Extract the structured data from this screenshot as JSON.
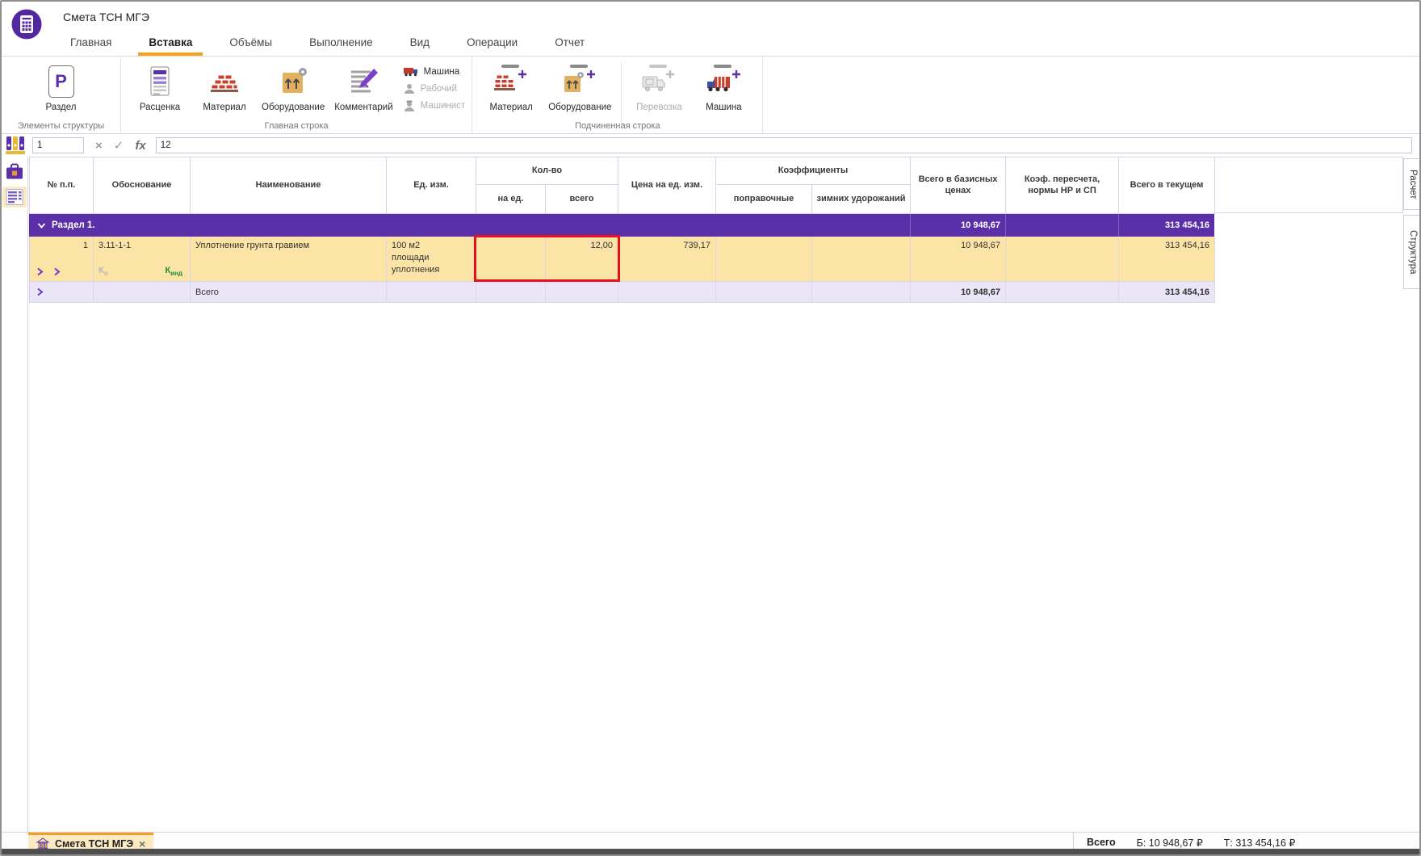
{
  "app": {
    "title": "Смета ТСН МГЭ"
  },
  "menu": {
    "tabs": [
      {
        "label": "Главная"
      },
      {
        "label": "Вставка",
        "active": true
      },
      {
        "label": "Объёмы"
      },
      {
        "label": "Выполнение"
      },
      {
        "label": "Вид"
      },
      {
        "label": "Операции"
      },
      {
        "label": "Отчет"
      }
    ]
  },
  "ribbon": {
    "groups": {
      "g1": "Элементы структуры",
      "g2": "Главная строка",
      "g3": "Подчиненная строка"
    },
    "buttons": {
      "razdel": "Раздел",
      "razdel_glyph": "P",
      "rascenka": "Расценка",
      "material": "Материал",
      "oborudovanie": "Оборудование",
      "kommentariy": "Комментарий",
      "mashina": "Машина",
      "rabochiy": "Рабочий",
      "mashinist": "Машинист",
      "sub_material": "Материал",
      "sub_oborudovanie": "Оборудование",
      "perevozka": "Перевозка",
      "sub_mashina": "Машина"
    }
  },
  "formula_bar": {
    "row_ref": "1",
    "cancel": "×",
    "confirm": "✓",
    "fx": "fx",
    "value": "12"
  },
  "table": {
    "headers": {
      "num": "№ п.п.",
      "basis": "Обоснование",
      "name": "Наименование",
      "unit": "Ед. изм.",
      "qty_group": "Кол-во",
      "qty_per": "на ед.",
      "qty_total": "всего",
      "unit_price": "Цена на ед. изм.",
      "coeff_group": "Коэффициенты",
      "coeff_corr": "поправочные",
      "coeff_winter": "зимних удорожаний",
      "total_base": "Всего в базисных ценах",
      "recalc": "Коэф. пересчета, нормы НР и СП",
      "total_current": "Всего в текущем"
    },
    "section_row": {
      "title": "Раздел 1.",
      "total_base": "10 948,67",
      "total_current": "313 454,16"
    },
    "item_row": {
      "num": "1",
      "code": "3.11-1-1",
      "kp_base": "К",
      "kp_sub": "п",
      "kind_base": "К",
      "kind_sub": "инд",
      "name": "Уплотнение грунта гравием",
      "unit": "100 м2 площади уплотнения",
      "qty_total": "12,00",
      "unit_price": "739,17",
      "total_base": "10 948,67",
      "total_current": "313 454,16"
    },
    "total_row": {
      "title": "Всего",
      "total_base": "10 948,67",
      "total_current": "313 454,16"
    }
  },
  "side_tabs": {
    "calc": "Расчет",
    "structure": "Структура"
  },
  "bottom_bar": {
    "tab": "Смета ТСН МГЭ",
    "close": "×",
    "total_label": "Всего",
    "base_value": "Б: 10 948,67 ₽",
    "current_value": "Т: 313 454,16 ₽"
  }
}
